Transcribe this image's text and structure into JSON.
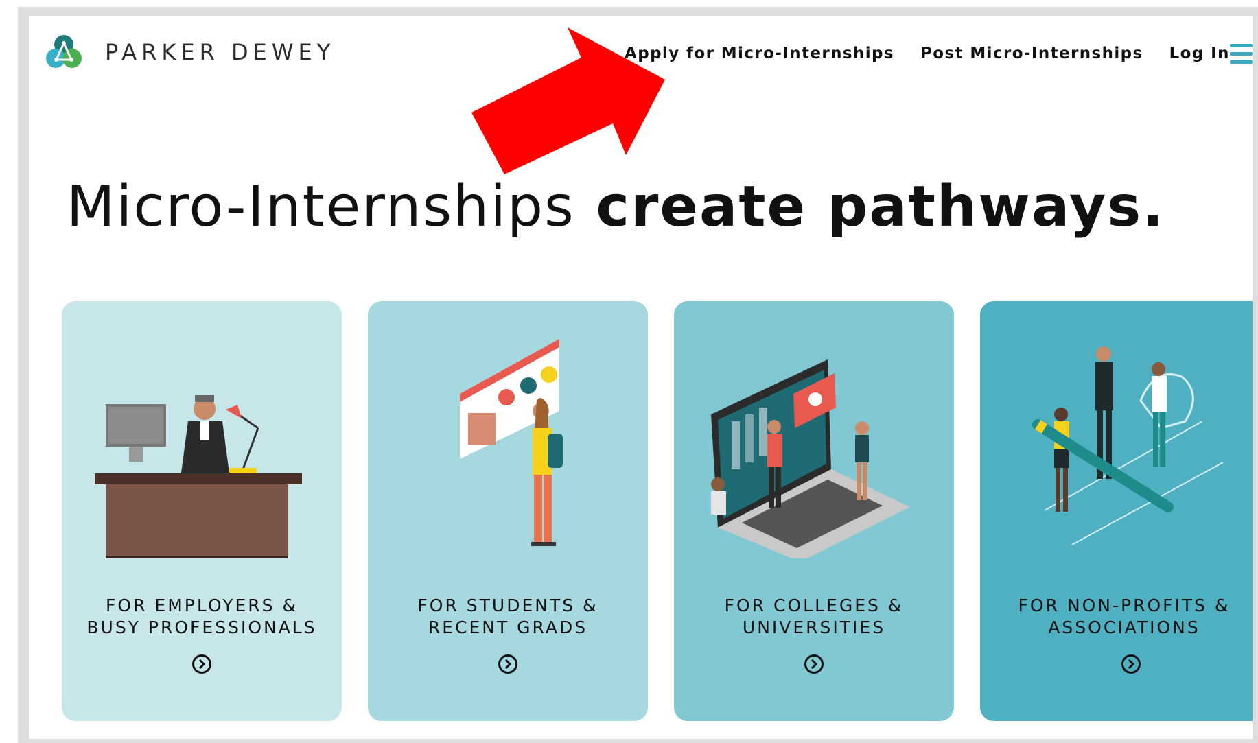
{
  "brand": {
    "name": "PARKER DEWEY"
  },
  "nav": {
    "apply_label": "Apply for Micro-Internships",
    "post_label": "Post Micro-Internships",
    "login_label": "Log In"
  },
  "headline": {
    "light": "Micro-Internships",
    "bold": "create pathways."
  },
  "cards": [
    {
      "line1": "FOR EMPLOYERS &",
      "line2": "BUSY PROFESSIONALS",
      "bg": "#c7e6ea"
    },
    {
      "line1": "FOR STUDENTS &",
      "line2": "RECENT GRADS",
      "bg": "#a6d8df"
    },
    {
      "line1": "FOR COLLEGES &",
      "line2": "UNIVERSITIES",
      "bg": "#82c8d3"
    },
    {
      "line1": "FOR NON-PROFITS &",
      "line2": "ASSOCIATIONS",
      "bg": "#4fb0c2"
    }
  ],
  "colors": {
    "accent": "#3aa9bf",
    "annotation_arrow": "#ff0000"
  }
}
